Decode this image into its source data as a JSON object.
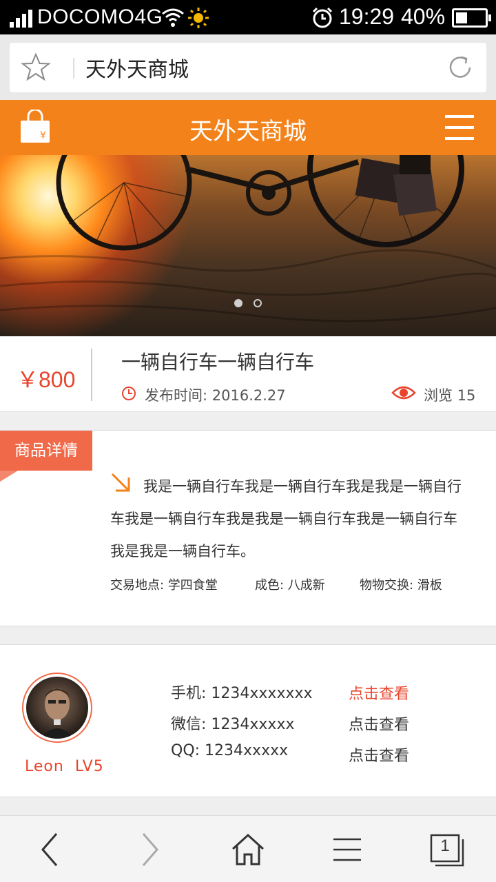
{
  "status_bar": {
    "carrier": "DOCOMO4G",
    "time": "19:29",
    "battery_text": "40%",
    "battery_level": 0.4,
    "icons": [
      "signal-icon",
      "wifi-icon",
      "sun-icon",
      "alarm-icon",
      "battery-icon"
    ]
  },
  "browser": {
    "url_text": "天外天商城",
    "icons": [
      "star-icon",
      "reload-icon"
    ]
  },
  "app_header": {
    "title": "天外天商城",
    "icons": [
      "shopping-bag-icon",
      "menu-icon"
    ],
    "accent_color": "#f3821a"
  },
  "banner": {
    "slide_count": 2,
    "active_slide": 1
  },
  "product": {
    "price": "￥800",
    "title": "一辆自行车一辆自行车",
    "publish_time": "发布时间: 2016.2.27",
    "views": "浏览 15",
    "price_color": "#e8452c"
  },
  "details": {
    "tag": "商品详情",
    "description": "我是一辆自行车我是一辆自行车我是我是一辆自行车我是一辆自行车我是我是一辆自行车我是一辆自行车我是我是一辆自行车。",
    "location": "交易地点: 学四食堂",
    "condition": "成色: 八成新",
    "exchange": "物物交换: 滑板",
    "tag_color": "#f06a4a"
  },
  "seller": {
    "name": "Leon",
    "level": "LV5",
    "phone": "手机: 1234xxxxxxx",
    "wechat": "微信: 1234xxxxx",
    "qq": "QQ: 1234xxxxx",
    "view_phone": "点击查看",
    "view_wechat": "点击查看",
    "view_qq": "点击查看",
    "view_active_color": "#e8452c"
  },
  "bottom_nav": {
    "icons": [
      "back-icon",
      "forward-icon",
      "home-icon",
      "menu-icon",
      "tabs-icon"
    ],
    "tab_count": "1"
  }
}
